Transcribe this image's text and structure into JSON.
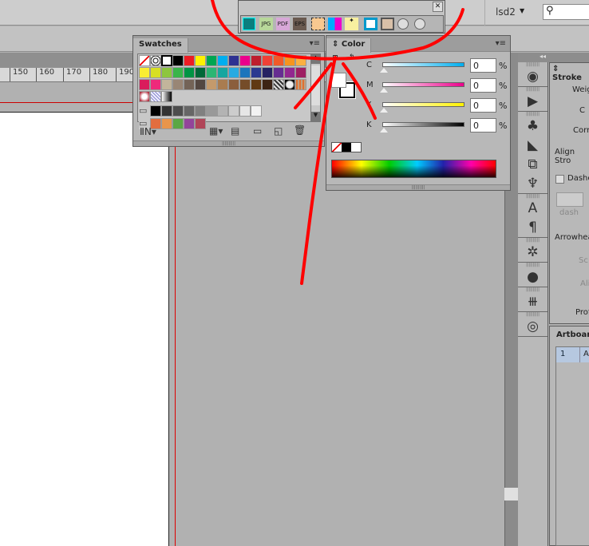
{
  "topbar": {
    "workspace": "lsd2",
    "search_placeholder": ""
  },
  "float_toolbar": {
    "buttons": [
      "artboard",
      "JPG",
      "PDF",
      "EPS",
      "crop",
      "color-sep",
      "arrows",
      "rect",
      "frame",
      "circle",
      "circle"
    ],
    "close": "✕"
  },
  "ruler": {
    "ticks": [
      "150",
      "160",
      "170",
      "180",
      "190"
    ]
  },
  "swatches": {
    "title": "Swatches",
    "rows": [
      [
        "none",
        "register",
        "#ffffff",
        "#000000",
        "#ed1c24",
        "#fff200",
        "#00a651",
        "#00aeef",
        "#2e3192",
        "#ec008c",
        "#be1e2d",
        "#ef4136",
        "#f15a29",
        "#f7941d",
        "#fbb040"
      ],
      [
        "#f9ed32",
        "#d7df23",
        "#8dc63f",
        "#39b54a",
        "#009444",
        "#006838",
        "#2bb673",
        "#16a6a0",
        "#27aae1",
        "#1c75bc",
        "#2b3990",
        "#262262",
        "#662d91",
        "#92278f",
        "#9e1f63"
      ],
      [
        "#da1c5c",
        "#ee2a7b",
        "#c2b59b",
        "#998675",
        "#736357",
        "#534741",
        "#c49a6c",
        "#a97c50",
        "#8b5e3c",
        "#754c29",
        "#603913",
        "#3c2415",
        "pattern-a",
        "pattern-b",
        "pattern-c"
      ],
      [
        "radial",
        "pattern-d",
        "linear"
      ],
      [
        "folder",
        "#000000",
        "#333333",
        "#4d4d4d",
        "#666666",
        "#808080",
        "#999999",
        "#b3b3b3",
        "#cccccc",
        "#e6e6e6",
        "#f2f2f2"
      ],
      [
        "folder",
        "#e26d3f",
        "#e8954b",
        "#5ba744",
        "#93449a",
        "#b04558"
      ]
    ]
  },
  "color": {
    "title": "Color",
    "channels": [
      {
        "label": "C",
        "value": "0",
        "unit": "%",
        "color": "#00aeef"
      },
      {
        "label": "M",
        "value": "0",
        "unit": "%",
        "color": "#ec008c"
      },
      {
        "label": "Y",
        "value": "0",
        "unit": "%",
        "color": "#fff200"
      },
      {
        "label": "K",
        "value": "0",
        "unit": "%",
        "color": "#000000"
      }
    ]
  },
  "stroke": {
    "title": "Stroke",
    "weight": "Weig",
    "cap": "C",
    "corner": "Corn",
    "align": "Align Stro",
    "dashed": "Dashe",
    "dash": "dash",
    "arrowheads": "Arrowhea",
    "scale": "Sc",
    "align2": "Ali",
    "profile": "Prof"
  },
  "artboards": {
    "title": "Artboard",
    "rows": [
      {
        "num": "1",
        "name": "A"
      }
    ]
  },
  "annotation_color": "#ff0000"
}
